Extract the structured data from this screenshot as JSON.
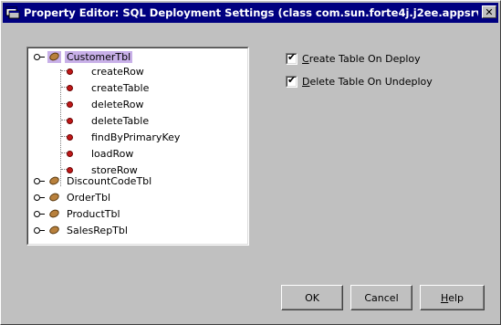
{
  "window": {
    "title": "Property Editor: SQL Deployment Settings (class com.sun.forte4j.j2ee.appsrv.R...",
    "close_label": "✕"
  },
  "tree": {
    "nodes": [
      {
        "label": "CustomerTbl",
        "expanded": true,
        "selected": true,
        "methods": [
          "createRow",
          "createTable",
          "deleteRow",
          "deleteTable",
          "findByPrimaryKey",
          "loadRow",
          "storeRow"
        ]
      },
      {
        "label": "DiscountCodeTbl",
        "expanded": false
      },
      {
        "label": "OrderTbl",
        "expanded": false
      },
      {
        "label": "ProductTbl",
        "expanded": false
      },
      {
        "label": "SalesRepTbl",
        "expanded": false
      }
    ]
  },
  "options": {
    "create_table": {
      "pre": "C",
      "rest": "reate Table On Deploy",
      "checked": true
    },
    "delete_table": {
      "pre": "D",
      "rest": "elete Table On Undeploy",
      "checked": true
    },
    "check_glyph": "✔"
  },
  "buttons": {
    "ok": "OK",
    "cancel": "Cancel",
    "help_pre": "H",
    "help_rest": "elp"
  },
  "colors": {
    "title_bar": "#000080",
    "selection": "#c8b0e8",
    "method_dot": "#c01818"
  }
}
